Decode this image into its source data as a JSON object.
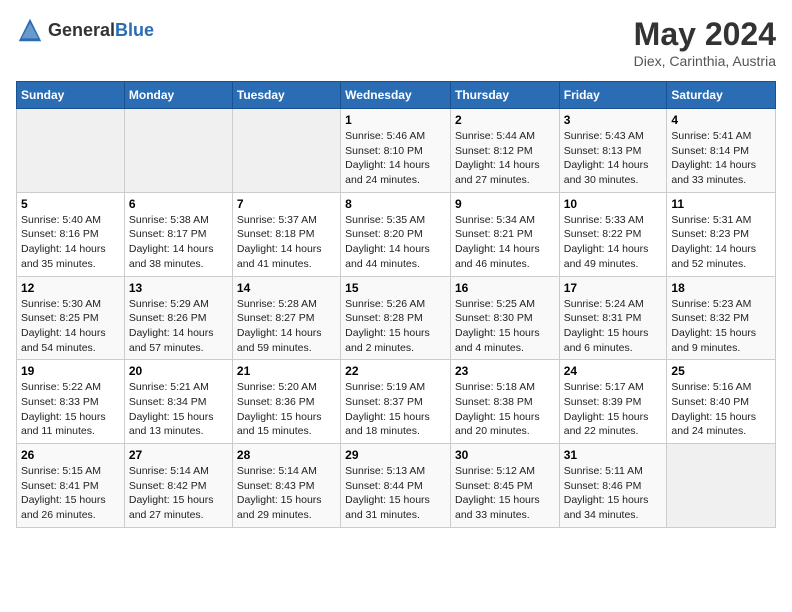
{
  "header": {
    "logo_general": "General",
    "logo_blue": "Blue",
    "title": "May 2024",
    "subtitle": "Diex, Carinthia, Austria"
  },
  "days_of_week": [
    "Sunday",
    "Monday",
    "Tuesday",
    "Wednesday",
    "Thursday",
    "Friday",
    "Saturday"
  ],
  "weeks": [
    [
      {
        "day": "",
        "info": ""
      },
      {
        "day": "",
        "info": ""
      },
      {
        "day": "",
        "info": ""
      },
      {
        "day": "1",
        "info": "Sunrise: 5:46 AM\nSunset: 8:10 PM\nDaylight: 14 hours and 24 minutes."
      },
      {
        "day": "2",
        "info": "Sunrise: 5:44 AM\nSunset: 8:12 PM\nDaylight: 14 hours and 27 minutes."
      },
      {
        "day": "3",
        "info": "Sunrise: 5:43 AM\nSunset: 8:13 PM\nDaylight: 14 hours and 30 minutes."
      },
      {
        "day": "4",
        "info": "Sunrise: 5:41 AM\nSunset: 8:14 PM\nDaylight: 14 hours and 33 minutes."
      }
    ],
    [
      {
        "day": "5",
        "info": "Sunrise: 5:40 AM\nSunset: 8:16 PM\nDaylight: 14 hours and 35 minutes."
      },
      {
        "day": "6",
        "info": "Sunrise: 5:38 AM\nSunset: 8:17 PM\nDaylight: 14 hours and 38 minutes."
      },
      {
        "day": "7",
        "info": "Sunrise: 5:37 AM\nSunset: 8:18 PM\nDaylight: 14 hours and 41 minutes."
      },
      {
        "day": "8",
        "info": "Sunrise: 5:35 AM\nSunset: 8:20 PM\nDaylight: 14 hours and 44 minutes."
      },
      {
        "day": "9",
        "info": "Sunrise: 5:34 AM\nSunset: 8:21 PM\nDaylight: 14 hours and 46 minutes."
      },
      {
        "day": "10",
        "info": "Sunrise: 5:33 AM\nSunset: 8:22 PM\nDaylight: 14 hours and 49 minutes."
      },
      {
        "day": "11",
        "info": "Sunrise: 5:31 AM\nSunset: 8:23 PM\nDaylight: 14 hours and 52 minutes."
      }
    ],
    [
      {
        "day": "12",
        "info": "Sunrise: 5:30 AM\nSunset: 8:25 PM\nDaylight: 14 hours and 54 minutes."
      },
      {
        "day": "13",
        "info": "Sunrise: 5:29 AM\nSunset: 8:26 PM\nDaylight: 14 hours and 57 minutes."
      },
      {
        "day": "14",
        "info": "Sunrise: 5:28 AM\nSunset: 8:27 PM\nDaylight: 14 hours and 59 minutes."
      },
      {
        "day": "15",
        "info": "Sunrise: 5:26 AM\nSunset: 8:28 PM\nDaylight: 15 hours and 2 minutes."
      },
      {
        "day": "16",
        "info": "Sunrise: 5:25 AM\nSunset: 8:30 PM\nDaylight: 15 hours and 4 minutes."
      },
      {
        "day": "17",
        "info": "Sunrise: 5:24 AM\nSunset: 8:31 PM\nDaylight: 15 hours and 6 minutes."
      },
      {
        "day": "18",
        "info": "Sunrise: 5:23 AM\nSunset: 8:32 PM\nDaylight: 15 hours and 9 minutes."
      }
    ],
    [
      {
        "day": "19",
        "info": "Sunrise: 5:22 AM\nSunset: 8:33 PM\nDaylight: 15 hours and 11 minutes."
      },
      {
        "day": "20",
        "info": "Sunrise: 5:21 AM\nSunset: 8:34 PM\nDaylight: 15 hours and 13 minutes."
      },
      {
        "day": "21",
        "info": "Sunrise: 5:20 AM\nSunset: 8:36 PM\nDaylight: 15 hours and 15 minutes."
      },
      {
        "day": "22",
        "info": "Sunrise: 5:19 AM\nSunset: 8:37 PM\nDaylight: 15 hours and 18 minutes."
      },
      {
        "day": "23",
        "info": "Sunrise: 5:18 AM\nSunset: 8:38 PM\nDaylight: 15 hours and 20 minutes."
      },
      {
        "day": "24",
        "info": "Sunrise: 5:17 AM\nSunset: 8:39 PM\nDaylight: 15 hours and 22 minutes."
      },
      {
        "day": "25",
        "info": "Sunrise: 5:16 AM\nSunset: 8:40 PM\nDaylight: 15 hours and 24 minutes."
      }
    ],
    [
      {
        "day": "26",
        "info": "Sunrise: 5:15 AM\nSunset: 8:41 PM\nDaylight: 15 hours and 26 minutes."
      },
      {
        "day": "27",
        "info": "Sunrise: 5:14 AM\nSunset: 8:42 PM\nDaylight: 15 hours and 27 minutes."
      },
      {
        "day": "28",
        "info": "Sunrise: 5:14 AM\nSunset: 8:43 PM\nDaylight: 15 hours and 29 minutes."
      },
      {
        "day": "29",
        "info": "Sunrise: 5:13 AM\nSunset: 8:44 PM\nDaylight: 15 hours and 31 minutes."
      },
      {
        "day": "30",
        "info": "Sunrise: 5:12 AM\nSunset: 8:45 PM\nDaylight: 15 hours and 33 minutes."
      },
      {
        "day": "31",
        "info": "Sunrise: 5:11 AM\nSunset: 8:46 PM\nDaylight: 15 hours and 34 minutes."
      },
      {
        "day": "",
        "info": ""
      }
    ]
  ]
}
